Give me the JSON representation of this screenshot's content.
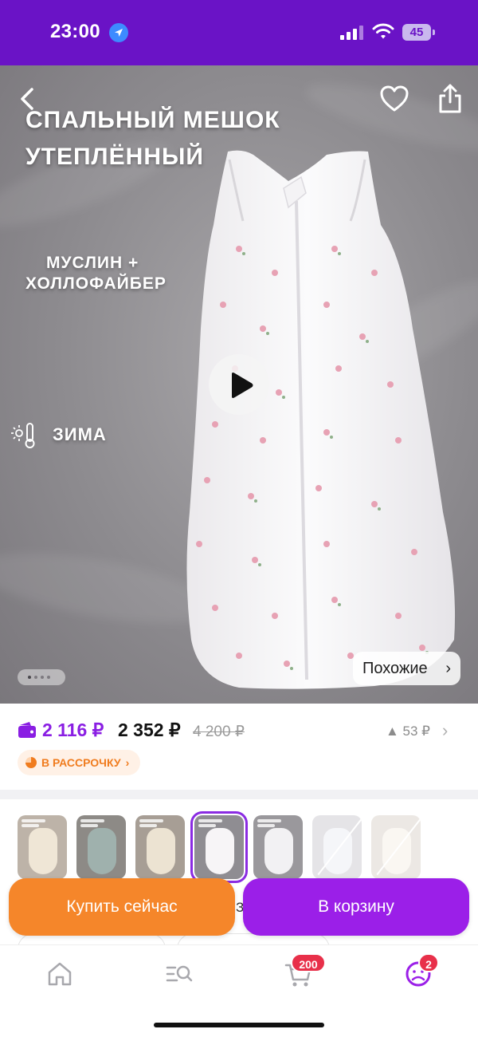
{
  "status_bar": {
    "time": "23:00",
    "battery": "45"
  },
  "hero": {
    "title_line1": "СПАЛЬНЫЙ МЕШОК",
    "title_line2": "УТЕПЛЁННЫЙ",
    "material_line1": "МУСЛИН +",
    "material_line2": "ХОЛЛОФАЙБЕР",
    "season": "ЗИМА",
    "similar_label": "Похожие",
    "similar_chevron": "›",
    "slide_count": 4,
    "active_slide": 1
  },
  "price": {
    "card_price": "2 116 ₽",
    "current_price": "2 352 ₽",
    "old_price": "4 200 ₽",
    "delta": "▲ 53 ₽",
    "chevron": "›",
    "installment_label": "В РАССРОЧКУ",
    "installment_chevron": "›"
  },
  "variants": {
    "selected_index": 3,
    "peek_text": "З"
  },
  "actions": {
    "buy_now_label": "Купить сейчас",
    "add_to_cart_label": "В корзину"
  },
  "tab_bar": {
    "items": [
      {
        "icon": "home-icon"
      },
      {
        "icon": "catalog-search-icon"
      },
      {
        "icon": "cart-icon",
        "badge": "200"
      },
      {
        "icon": "profile-icon",
        "badge": "2"
      }
    ]
  },
  "colors": {
    "brand_purple": "#6a13c6",
    "cart_purple": "#9b1fe8",
    "buy_orange": "#f5862a",
    "badge_red": "#e8304a"
  }
}
